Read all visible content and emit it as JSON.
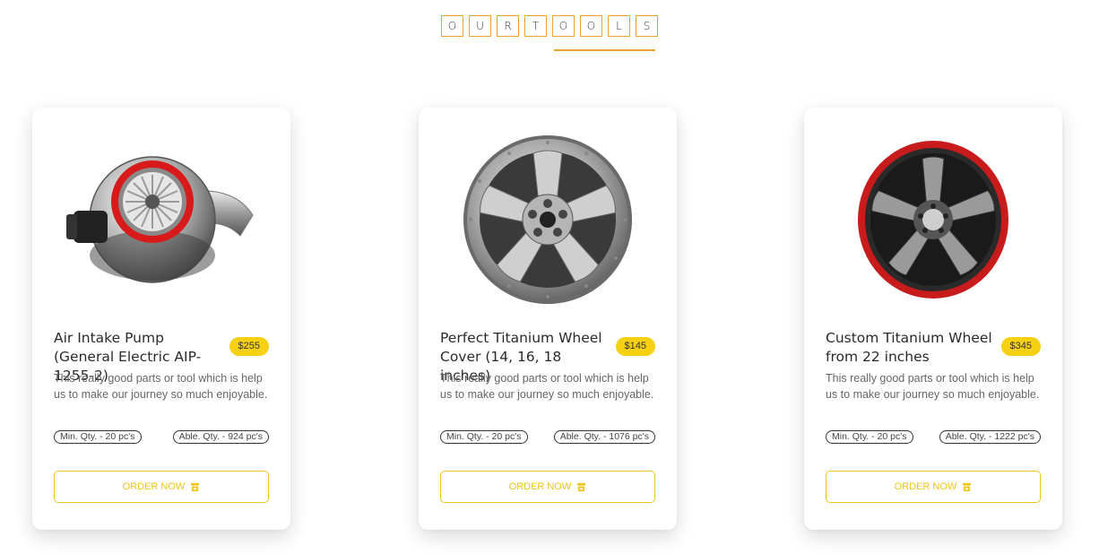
{
  "heading": {
    "letters": [
      "O",
      "U",
      "R",
      "T",
      "O",
      "O",
      "L",
      "S"
    ]
  },
  "accent_color": "#e8a32e",
  "button_color": "#f0c419",
  "badge_color": "#f6d113",
  "products": [
    {
      "title": "Air Intake Pump (General Electric AIP-1255-2)",
      "price": "$255",
      "description": "This really good parts or tool which is help us to make our journey so much enjoyable.",
      "min_qty": "Min. Qty. - 20 pc's",
      "able_qty": "Able. Qty. - 924 pc's",
      "button_label": "ORDER NOW",
      "image": "turbocharger"
    },
    {
      "title": "Perfect Titanium Wheel Cover (14, 16, 18 inches)",
      "price": "$145",
      "description": "This really good parts or tool which is help us to make our journey so much enjoyable.",
      "min_qty": "Min. Qty. - 20 pc's",
      "able_qty": "Able. Qty. - 1076 pc's",
      "button_label": "ORDER NOW",
      "image": "chrome-wheel-cover"
    },
    {
      "title": "Custom Titanium Wheel from 22 inches",
      "price": "$345",
      "description": "This really good parts or tool which is help us to make our journey so much enjoyable.",
      "min_qty": "Min. Qty. - 20 pc's",
      "able_qty": "Able. Qty. - 1222 pc's",
      "button_label": "ORDER NOW",
      "image": "red-rim-wheel"
    }
  ]
}
